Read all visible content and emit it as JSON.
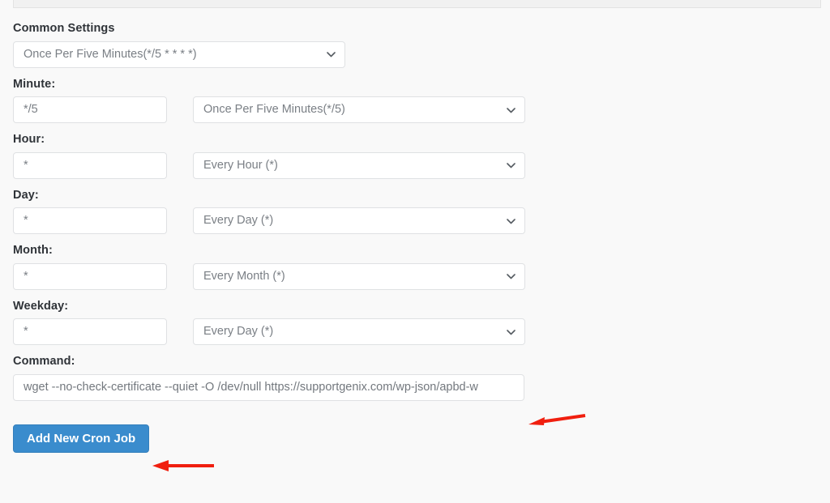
{
  "page": {
    "background_color": "#f9f9f9",
    "accent_color": "#3a8ccd",
    "annotation_color": "#f01f0f"
  },
  "form": {
    "common_settings": {
      "label": "Common Settings",
      "select_value": "Once Per Five Minutes(*/5 * * * *)",
      "chevron_icon": "chevron-down-icon"
    },
    "rows": [
      {
        "key": "minute",
        "label": "Minute:",
        "input_value": "*/5",
        "input_placeholder": "",
        "select_value": "Once Per Five Minutes(*/5)",
        "chevron_icon": "chevron-down-icon"
      },
      {
        "key": "hour",
        "label": "Hour:",
        "input_value": "*",
        "input_placeholder": "",
        "select_value": "Every Hour (*)",
        "chevron_icon": "chevron-down-icon"
      },
      {
        "key": "day",
        "label": "Day:",
        "input_value": "*",
        "input_placeholder": "",
        "select_value": "Every Day (*)",
        "chevron_icon": "chevron-down-icon"
      },
      {
        "key": "month",
        "label": "Month:",
        "input_value": "*",
        "input_placeholder": "",
        "select_value": "Every Month (*)",
        "chevron_icon": "chevron-down-icon"
      },
      {
        "key": "weekday",
        "label": "Weekday:",
        "input_value": "*",
        "input_placeholder": "",
        "select_value": "Every Day (*)",
        "chevron_icon": "chevron-down-icon"
      }
    ],
    "command": {
      "label": "Command:",
      "value": "wget --no-check-certificate --quiet -O /dev/null https://supportgenix.com/wp-json/apbd-w",
      "placeholder": ""
    },
    "submit": {
      "label": "Add New Cron Job"
    }
  },
  "annotations": [
    {
      "name": "arrow-pointing-at-command-field",
      "direction": "left"
    },
    {
      "name": "arrow-pointing-at-add-button",
      "direction": "left"
    }
  ]
}
